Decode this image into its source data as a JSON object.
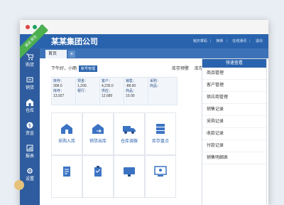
{
  "app": {
    "company": "某某集团公司",
    "ribbon": "速达·原生"
  },
  "header": {
    "links": [
      "销天革码",
      "换新",
      "在线通讯",
      "退出"
    ]
  },
  "sidebar": {
    "items": [
      {
        "label": "购货",
        "icon": "cart-icon"
      },
      {
        "label": "销货",
        "icon": "sales-icon"
      },
      {
        "label": "仓库",
        "icon": "warehouse-icon"
      },
      {
        "label": "资金",
        "icon": "money-icon"
      },
      {
        "label": "报表",
        "icon": "report-icon"
      },
      {
        "label": "设置",
        "icon": "gear-icon"
      }
    ]
  },
  "tabs": {
    "home": "首页",
    "add": "+"
  },
  "greeting": {
    "text": "下午好，小雨",
    "badge": "账号管理"
  },
  "stock": {
    "warning": "库存预警",
    "query": "库存查询"
  },
  "stats": [
    {
      "line1": "库存：",
      "v1": "308.0",
      "line2": "库存：",
      "v2": "13,927"
    },
    {
      "line1": "现金：",
      "v1": "1,200.",
      "line2": "银行：",
      "v2": ""
    },
    {
      "line1": "客户：",
      "v1": "4,235.0",
      "line2": "供应：",
      "v2": "12,680"
    },
    {
      "line1": "销售：",
      "v1": "-88.00",
      "line2": "商品：",
      "v2": "10.00"
    },
    {
      "line1": "采购：",
      "v1": "",
      "line2": "商品：",
      "v2": ""
    }
  ],
  "grid": [
    {
      "label": "采购入库",
      "icon": "purchase-icon"
    },
    {
      "label": "销货出库",
      "icon": "sales-out-icon"
    },
    {
      "label": "仓库调拨",
      "icon": "truck-icon"
    },
    {
      "label": "库存盘点",
      "icon": "inventory-icon"
    },
    {
      "label": "",
      "icon": "document-icon"
    },
    {
      "label": "",
      "icon": "clipboard-icon"
    },
    {
      "label": "",
      "icon": "monitor-icon"
    },
    {
      "label": "",
      "icon": "screen-icon"
    }
  ],
  "quick": {
    "title": "快速查看",
    "items": [
      "商品管理",
      "客户管理",
      "供应商管理",
      "销售记录",
      "采购记录",
      "收款记录",
      "付款记录",
      "销售明细表"
    ]
  },
  "colors": {
    "primary": "#2a63ad",
    "sidebar": "#2e5c9e",
    "ribbon": "#4caf50"
  }
}
